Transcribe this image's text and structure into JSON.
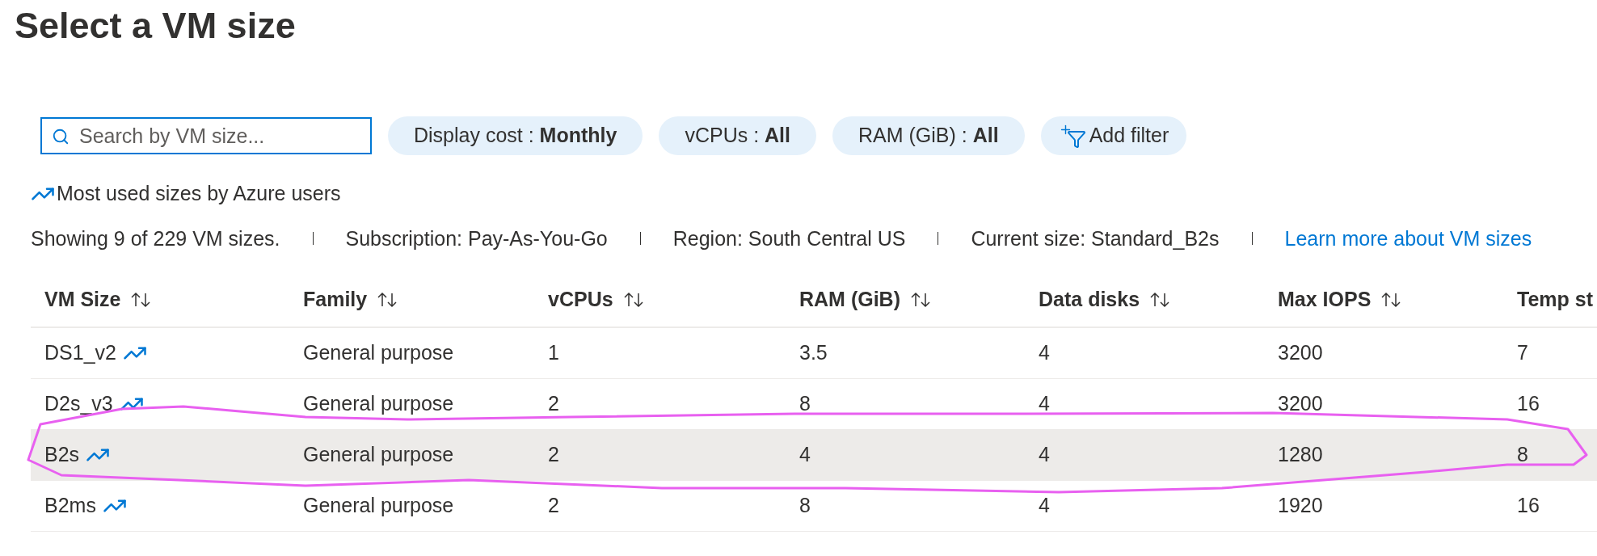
{
  "title": "Select a VM size",
  "search": {
    "placeholder": "Search by VM size..."
  },
  "filters": [
    {
      "kind": "pill",
      "text": "Display cost : **Monthly**"
    },
    {
      "kind": "pill",
      "text": "vCPUs : **All**"
    },
    {
      "kind": "pill",
      "text": "RAM (GiB) : **All**"
    },
    {
      "kind": "add",
      "text": "Add filter"
    }
  ],
  "most_used_note": "Most used sizes by Azure users",
  "info": [
    {
      "kind": "text",
      "text": "Showing 9 of 229 VM sizes."
    },
    {
      "kind": "text",
      "text": "Subscription: Pay-As-You-Go"
    },
    {
      "kind": "text",
      "text": "Region: South Central US"
    },
    {
      "kind": "text",
      "text": "Current size: Standard_B2s"
    },
    {
      "kind": "link",
      "text": "Learn more about VM sizes"
    }
  ],
  "table": {
    "columns": [
      {
        "label": "VM Size",
        "sortable": true
      },
      {
        "label": "Family",
        "sortable": true
      },
      {
        "label": "vCPUs",
        "sortable": true
      },
      {
        "label": "RAM (GiB)",
        "sortable": true
      },
      {
        "label": "Data disks",
        "sortable": true
      },
      {
        "label": "Max IOPS",
        "sortable": true
      },
      {
        "label": "Temp st",
        "sortable": false
      }
    ],
    "rows": [
      {
        "cells": [
          "DS1_v2",
          "General purpose",
          "1",
          "3.5",
          "4",
          "3200",
          "7"
        ],
        "most_used": true,
        "selected": false,
        "circled": false
      },
      {
        "cells": [
          "D2s_v3",
          "General purpose",
          "2",
          "8",
          "4",
          "3200",
          "16"
        ],
        "most_used": true,
        "selected": false,
        "circled": false
      },
      {
        "cells": [
          "B2s",
          "General purpose",
          "2",
          "4",
          "4",
          "1280",
          "8"
        ],
        "most_used": true,
        "selected": true,
        "circled": true
      },
      {
        "cells": [
          "B2ms",
          "General purpose",
          "2",
          "8",
          "4",
          "1920",
          "16"
        ],
        "most_used": true,
        "selected": false,
        "circled": false
      }
    ]
  }
}
